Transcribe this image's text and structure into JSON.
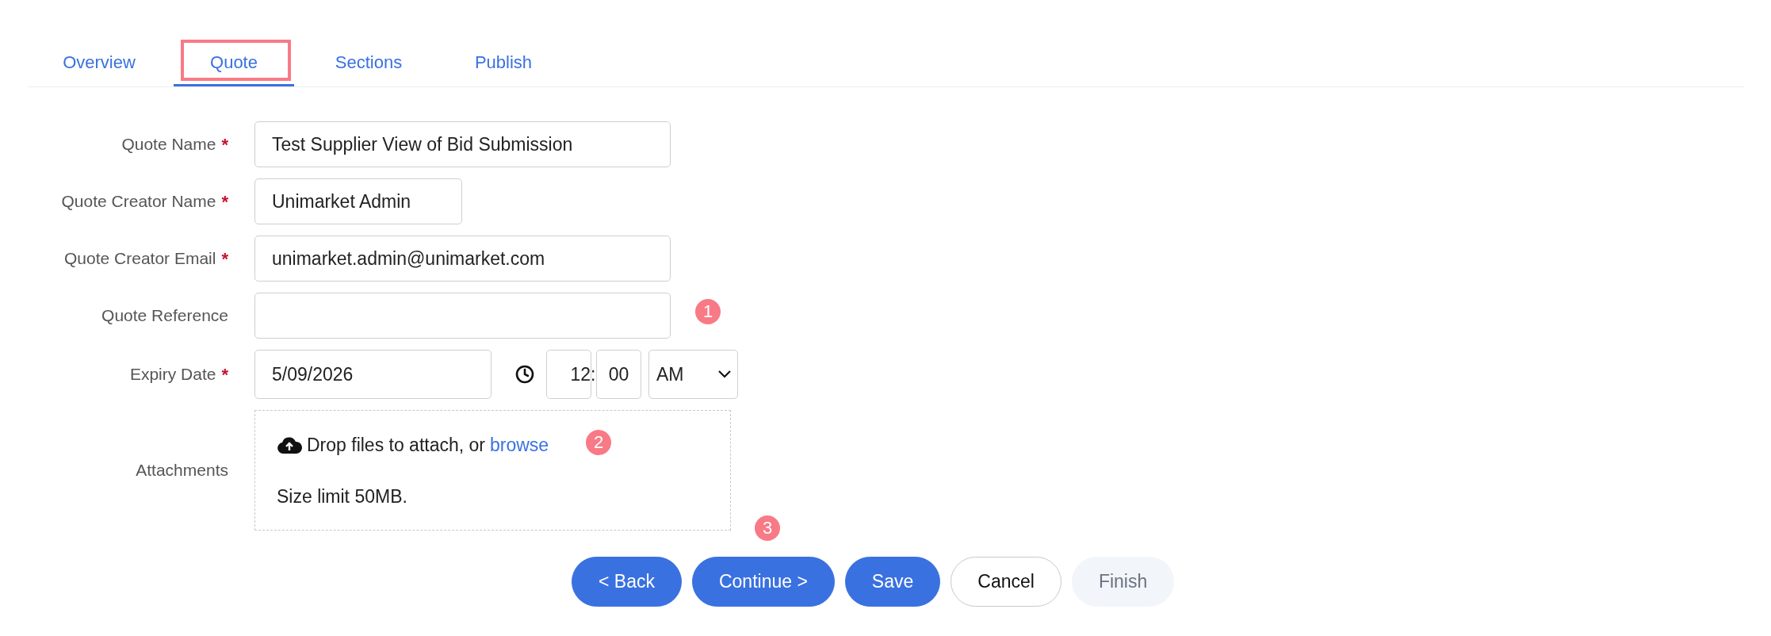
{
  "tabs": [
    {
      "label": "Overview",
      "selected": false,
      "highlighted": false
    },
    {
      "label": "Quote",
      "selected": true,
      "highlighted": true
    },
    {
      "label": "Sections",
      "selected": false,
      "highlighted": false
    },
    {
      "label": "Publish",
      "selected": false,
      "highlighted": false
    }
  ],
  "fields": [
    {
      "kind": "text",
      "label": "Quote Name",
      "required": true,
      "value": "Test Supplier View of Bid Submission"
    },
    {
      "kind": "short_text",
      "label": "Quote Creator Name",
      "required": true,
      "value": "Unimarket Admin"
    },
    {
      "kind": "text",
      "label": "Quote Creator Email",
      "required": true,
      "value": "unimarket.admin@unimarket.com"
    },
    {
      "kind": "text",
      "label": "Quote Reference",
      "required": false,
      "badge": "1"
    },
    {
      "kind": "datetime",
      "label": "Expiry Date",
      "required": true,
      "date": "5/09/2026",
      "hour": "12",
      "separator": ":",
      "minute": "00",
      "period": "AM"
    },
    {
      "kind": "attachments",
      "label": "Attachments",
      "required": false,
      "drop_text": "Drop files to attach, or",
      "browse_link": "browse",
      "limit": "Size limit 50MB.",
      "badge": "2",
      "badge_below": "3"
    }
  ],
  "required_mark": "*",
  "buttons": [
    {
      "label": "< Back",
      "kind": "primary"
    },
    {
      "label": "Continue >",
      "kind": "primary"
    },
    {
      "label": "Save",
      "kind": "primary"
    },
    {
      "label": "Cancel",
      "kind": "outline"
    },
    {
      "label": "Finish",
      "kind": "disabled"
    }
  ]
}
